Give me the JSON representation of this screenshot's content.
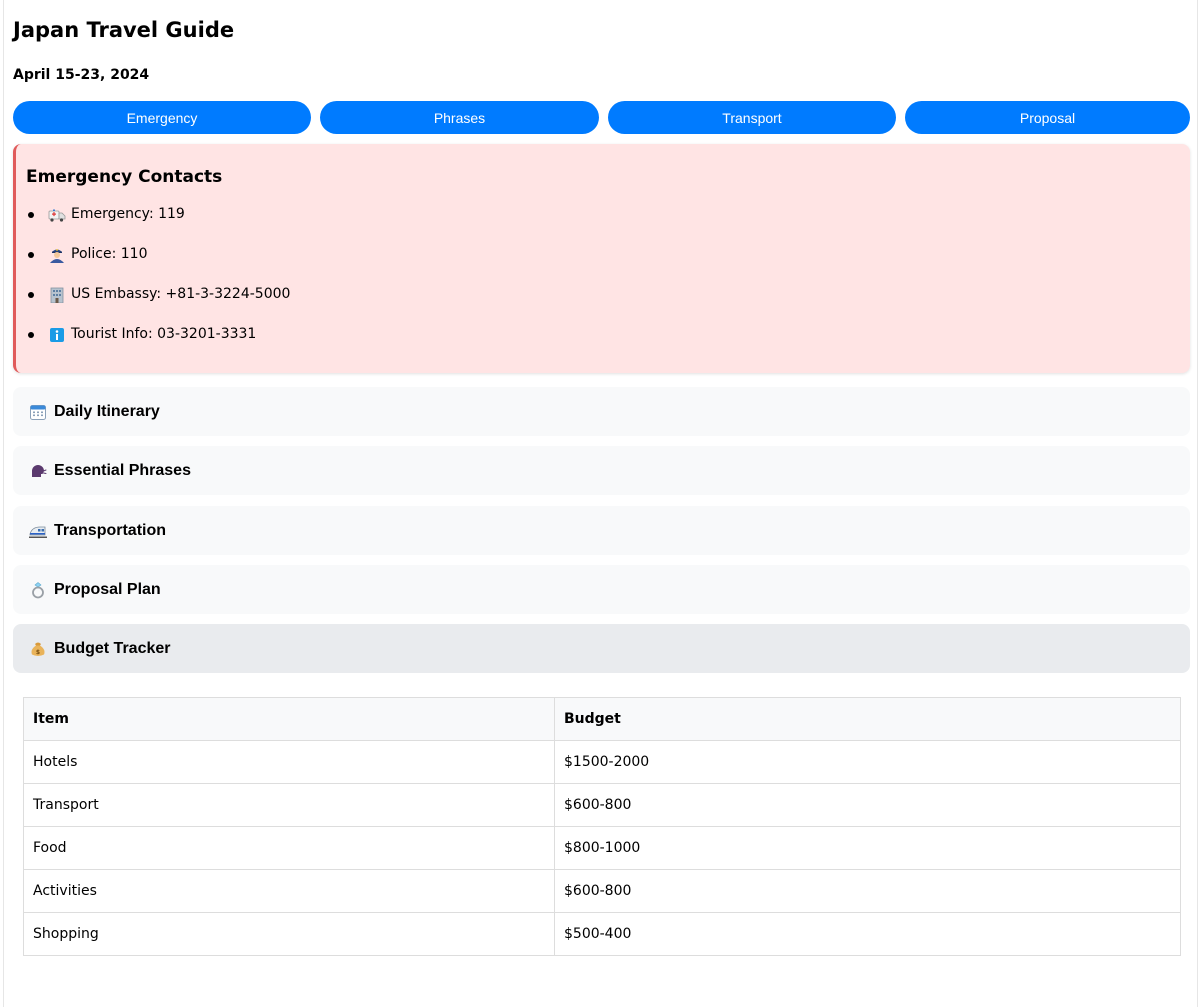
{
  "page": {
    "title": "Japan Travel Guide",
    "date": "April 15-23, 2024"
  },
  "nav": [
    {
      "label": "Emergency"
    },
    {
      "label": "Phrases"
    },
    {
      "label": "Transport"
    },
    {
      "label": "Proposal"
    }
  ],
  "emergency": {
    "heading": "Emergency Contacts",
    "items": [
      {
        "icon": "ambulance-icon",
        "text": "Emergency: 119"
      },
      {
        "icon": "police-officer-icon",
        "text": "Police: 110"
      },
      {
        "icon": "office-building-icon",
        "text": "US Embassy: +81-3-3224-5000"
      },
      {
        "icon": "information-icon",
        "text": "Tourist Info: 03-3201-3331"
      }
    ]
  },
  "sections": [
    {
      "icon": "calendar-icon",
      "label": "Daily Itinerary"
    },
    {
      "icon": "speaking-head-icon",
      "label": "Essential Phrases"
    },
    {
      "icon": "train-icon",
      "label": "Transportation"
    },
    {
      "icon": "ring-icon",
      "label": "Proposal Plan"
    },
    {
      "icon": "money-bag-icon",
      "label": "Budget Tracker"
    }
  ],
  "budget": {
    "headers": [
      "Item",
      "Budget"
    ],
    "rows": [
      [
        "Hotels",
        "$1500-2000"
      ],
      [
        "Transport",
        "$600-800"
      ],
      [
        "Food",
        "$800-1000"
      ],
      [
        "Activities",
        "$600-800"
      ],
      [
        "Shopping",
        "$500-400"
      ]
    ]
  },
  "colors": {
    "accent": "#007bff",
    "emergency_bg": "#ffe4e4",
    "emergency_border": "#e05a5a",
    "section_bg": "#f8f9fa",
    "section_active_bg": "#e9ebee"
  }
}
